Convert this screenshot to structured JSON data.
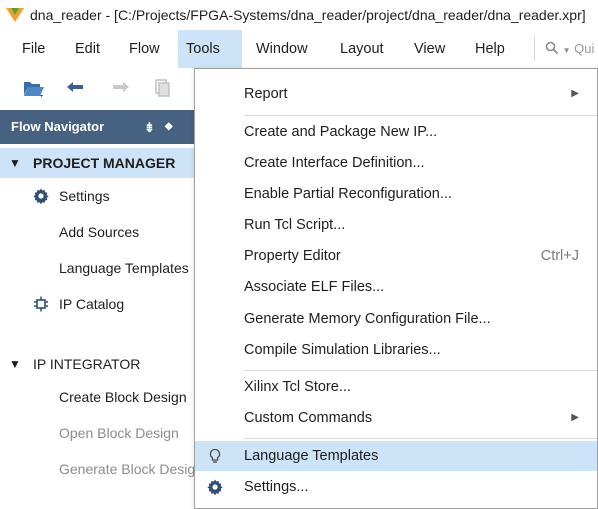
{
  "window": {
    "title": "dna_reader - [C:/Projects/FPGA-Systems/dna_reader/project/dna_reader/dna_reader.xpr]"
  },
  "menubar": {
    "items": [
      {
        "label": "File"
      },
      {
        "label": "Edit"
      },
      {
        "label": "Flow"
      },
      {
        "label": "Tools"
      },
      {
        "label": "Window"
      },
      {
        "label": "Layout"
      },
      {
        "label": "View"
      },
      {
        "label": "Help"
      }
    ],
    "quick_access_placeholder": "Qui"
  },
  "toolbar": {
    "icons": [
      "open-folder-icon",
      "undo-icon",
      "redo-icon",
      "copy-icon"
    ]
  },
  "flow_navigator": {
    "title": "Flow Navigator",
    "sections": [
      {
        "label": "PROJECT MANAGER",
        "items": [
          {
            "label": "Settings",
            "icon": "gear-icon"
          },
          {
            "label": "Add Sources"
          },
          {
            "label": "Language Templates"
          },
          {
            "label": "IP Catalog",
            "icon": "ip-catalog-icon"
          }
        ]
      },
      {
        "label": "IP INTEGRATOR",
        "items": [
          {
            "label": "Create Block Design"
          },
          {
            "label": "Open Block Design"
          },
          {
            "label": "Generate Block Design"
          }
        ]
      }
    ]
  },
  "tools_menu": {
    "items": [
      {
        "label": "Report",
        "submenu": true
      },
      {
        "label": "Create and Package New IP..."
      },
      {
        "label": "Create Interface Definition..."
      },
      {
        "label": "Enable Partial Reconfiguration..."
      },
      {
        "label": "Run Tcl Script..."
      },
      {
        "label": "Property Editor",
        "shortcut": "Ctrl+J"
      },
      {
        "label": "Associate ELF Files..."
      },
      {
        "label": "Generate Memory Configuration File..."
      },
      {
        "label": "Compile Simulation Libraries..."
      },
      {
        "label": "Xilinx Tcl Store..."
      },
      {
        "label": "Custom Commands",
        "submenu": true
      },
      {
        "label": "Language Templates",
        "icon": "lightbulb-icon"
      },
      {
        "label": "Settings...",
        "icon": "gear-icon"
      }
    ]
  },
  "colors": {
    "menu_highlight": "#cde3f7",
    "nav_header": "#466280",
    "disabled_text": "#8c8c8c"
  }
}
